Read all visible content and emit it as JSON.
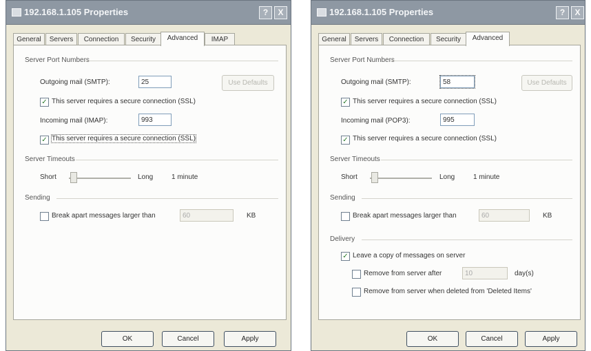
{
  "left": {
    "title": "192.168.1.105 Properties",
    "help_button": "?",
    "close_button": "X",
    "tabs": [
      "General",
      "Servers",
      "Connection",
      "Security",
      "Advanced",
      "IMAP"
    ],
    "group_ports": "Server Port Numbers",
    "outgoing_label": "Outgoing mail (SMTP):",
    "outgoing_value": "25",
    "use_defaults": "Use Defaults",
    "ssl_outgoing": "This server requires a secure connection (SSL)",
    "incoming_label": "Incoming mail (IMAP):",
    "incoming_value": "993",
    "ssl_incoming": "This server requires a secure connection (SSL)",
    "group_timeouts": "Server Timeouts",
    "short": "Short",
    "long": "Long",
    "timeout_value": "1 minute",
    "group_sending": "Sending",
    "break_apart": "Break apart messages larger than",
    "break_value": "60",
    "kb": "KB",
    "ok": "OK",
    "cancel": "Cancel",
    "apply": "Apply"
  },
  "right": {
    "title": "192.168.1.105 Properties",
    "help_button": "?",
    "close_button": "X",
    "tabs": [
      "General",
      "Servers",
      "Connection",
      "Security",
      "Advanced"
    ],
    "group_ports": "Server Port Numbers",
    "outgoing_label": "Outgoing mail (SMTP):",
    "outgoing_value": "58",
    "use_defaults": "Use Defaults",
    "ssl_outgoing": "This server requires a secure connection (SSL)",
    "incoming_label": "Incoming mail (POP3):",
    "incoming_value": "995",
    "ssl_incoming": "This server requires a secure connection (SSL)",
    "group_timeouts": "Server Timeouts",
    "short": "Short",
    "long": "Long",
    "timeout_value": "1 minute",
    "group_sending": "Sending",
    "break_apart": "Break apart messages larger than",
    "break_value": "60",
    "kb": "KB",
    "group_delivery": "Delivery",
    "leave_copy": "Leave a copy of messages on server",
    "remove_after": "Remove from server after",
    "remove_days_value": "10",
    "days": "day(s)",
    "remove_deleted": "Remove from server when deleted from 'Deleted Items'",
    "ok": "OK",
    "cancel": "Cancel",
    "apply": "Apply"
  },
  "checkmark": "✓"
}
